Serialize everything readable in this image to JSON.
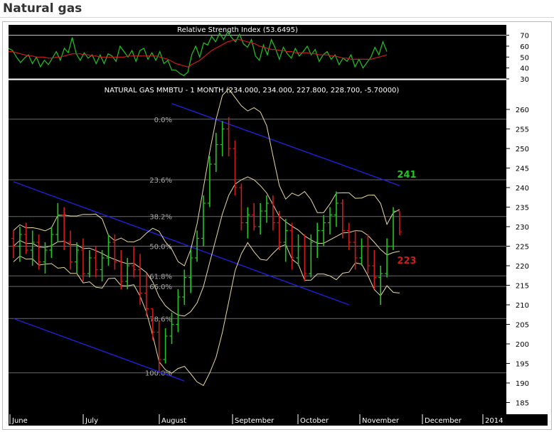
{
  "page": {
    "title": "Natural gas"
  },
  "chart_data": [
    {
      "type": "line",
      "title": "Relative Strength Index (53.6495)",
      "ylim": [
        30,
        73
      ],
      "yticks": [
        "70",
        "60",
        "50",
        "40",
        "30"
      ],
      "series": [
        {
          "color": "#22c422",
          "values": [
            58,
            56,
            50,
            45,
            49,
            52,
            44,
            50,
            41,
            47,
            43,
            49,
            55,
            47,
            58,
            54,
            68,
            53,
            47,
            54,
            49,
            52,
            44,
            52,
            44,
            53,
            51,
            46,
            60,
            55,
            50,
            56,
            46,
            56,
            58,
            48,
            54,
            47,
            55,
            44,
            47,
            38,
            38,
            35,
            33,
            36,
            52,
            60,
            50,
            63,
            61,
            69,
            64,
            72,
            66,
            73,
            68,
            64,
            71,
            62,
            59,
            66,
            51,
            47,
            61,
            52,
            66,
            58,
            48,
            59,
            53,
            49,
            58,
            51,
            55,
            60,
            52,
            57,
            46,
            52,
            55,
            48,
            52,
            43,
            49,
            46,
            52,
            41,
            48,
            40,
            45,
            50,
            59,
            52,
            64,
            55
          ]
        },
        {
          "color": "#d11a1a",
          "values": [
            55,
            55,
            54,
            53,
            52,
            51,
            51,
            50,
            50,
            50,
            49,
            49,
            50,
            50,
            51,
            52,
            53,
            53,
            53,
            52,
            52,
            51,
            51,
            50,
            50,
            50,
            50,
            50,
            50,
            50,
            51,
            51,
            51,
            51,
            51,
            51,
            51,
            51,
            50,
            49,
            48,
            46,
            44,
            43,
            42,
            41,
            43,
            45,
            47,
            50,
            53,
            56,
            58,
            60,
            62,
            64,
            65,
            66,
            66,
            65,
            64,
            63,
            62,
            60,
            59,
            58,
            57,
            57,
            56,
            56,
            55,
            55,
            54,
            54,
            54,
            54,
            53,
            53,
            52,
            52,
            52,
            51,
            51,
            50,
            49,
            49,
            48,
            48,
            48,
            48,
            48,
            48,
            49,
            50,
            51,
            52
          ]
        }
      ]
    },
    {
      "type": "bar",
      "subtype": "ohlc",
      "title": "NATURAL GAS MMBTU - 1 MONTH (234.000, 234.000, 227.800, 228.700, -5.70000)",
      "ylim": [
        182,
        262
      ],
      "yticks": [
        "260",
        "255",
        "250",
        "245",
        "240",
        "235",
        "230",
        "225",
        "220",
        "215",
        "210",
        "205",
        "200",
        "195",
        "190",
        "185"
      ],
      "xticks": [
        "June",
        "July",
        "August",
        "September",
        "October",
        "November",
        "December",
        "2014"
      ],
      "fib_levels": [
        {
          "label": "0.0%",
          "value": 257.5
        },
        {
          "label": "23.6%",
          "value": 242.0
        },
        {
          "label": "38.2%",
          "value": 232.6
        },
        {
          "label": "50.0%",
          "value": 225.0
        },
        {
          "label": "61.8%",
          "value": 217.4
        },
        {
          "label": "66.0%",
          "value": 214.7
        },
        {
          "label": "78.6%",
          "value": 206.5
        },
        {
          "label": "100.0%",
          "value": 192.6
        }
      ],
      "annotations": [
        {
          "text": "241",
          "color": "#22c422",
          "value": 243.5
        },
        {
          "text": "223",
          "color": "#d11a1a",
          "value": 221.5
        }
      ],
      "channels": [
        {
          "from": [
            0,
            241.5
          ],
          "to": [
            53,
            210.0
          ]
        },
        {
          "from": [
            0,
            206.5
          ],
          "to": [
            27,
            190.5
          ]
        },
        {
          "from": [
            25,
            261.5
          ],
          "to": [
            61,
            240.5
          ]
        }
      ],
      "candles": [
        {
          "o": 227,
          "h": 229,
          "l": 222,
          "c": 225
        },
        {
          "o": 225,
          "h": 230,
          "l": 221,
          "c": 228
        },
        {
          "o": 228,
          "h": 231,
          "l": 223,
          "c": 224
        },
        {
          "o": 224,
          "h": 229,
          "l": 220,
          "c": 226
        },
        {
          "o": 226,
          "h": 228,
          "l": 219,
          "c": 221
        },
        {
          "o": 221,
          "h": 226,
          "l": 218,
          "c": 224
        },
        {
          "o": 224,
          "h": 230,
          "l": 222,
          "c": 228
        },
        {
          "o": 228,
          "h": 236,
          "l": 226,
          "c": 233
        },
        {
          "o": 233,
          "h": 235,
          "l": 224,
          "c": 226
        },
        {
          "o": 226,
          "h": 229,
          "l": 219,
          "c": 221
        },
        {
          "o": 221,
          "h": 226,
          "l": 218,
          "c": 224
        },
        {
          "o": 224,
          "h": 227,
          "l": 216,
          "c": 218
        },
        {
          "o": 218,
          "h": 224,
          "l": 217,
          "c": 222
        },
        {
          "o": 222,
          "h": 225,
          "l": 217,
          "c": 219
        },
        {
          "o": 219,
          "h": 224,
          "l": 216,
          "c": 222
        },
        {
          "o": 222,
          "h": 228,
          "l": 220,
          "c": 226
        },
        {
          "o": 226,
          "h": 228,
          "l": 219,
          "c": 221
        },
        {
          "o": 221,
          "h": 224,
          "l": 214,
          "c": 216
        },
        {
          "o": 216,
          "h": 222,
          "l": 214,
          "c": 220
        },
        {
          "o": 220,
          "h": 225,
          "l": 217,
          "c": 219
        },
        {
          "o": 219,
          "h": 223,
          "l": 210,
          "c": 213
        },
        {
          "o": 213,
          "h": 218,
          "l": 207,
          "c": 209
        },
        {
          "o": 209,
          "h": 207,
          "l": 201,
          "c": 203
        },
        {
          "o": 203,
          "h": 206,
          "l": 193,
          "c": 196
        },
        {
          "o": 196,
          "h": 204,
          "l": 195,
          "c": 202
        },
        {
          "o": 202,
          "h": 208,
          "l": 200,
          "c": 205
        },
        {
          "o": 205,
          "h": 214,
          "l": 203,
          "c": 212
        },
        {
          "o": 212,
          "h": 219,
          "l": 210,
          "c": 217
        },
        {
          "o": 217,
          "h": 224,
          "l": 213,
          "c": 222
        },
        {
          "o": 222,
          "h": 229,
          "l": 221,
          "c": 227
        },
        {
          "o": 227,
          "h": 238,
          "l": 225,
          "c": 236
        },
        {
          "o": 236,
          "h": 248,
          "l": 235,
          "c": 246
        },
        {
          "o": 246,
          "h": 254,
          "l": 244,
          "c": 251
        },
        {
          "o": 251,
          "h": 257,
          "l": 248,
          "c": 255
        },
        {
          "o": 255,
          "h": 258,
          "l": 248,
          "c": 250
        },
        {
          "o": 250,
          "h": 252,
          "l": 238,
          "c": 240
        },
        {
          "o": 240,
          "h": 241,
          "l": 229,
          "c": 231
        },
        {
          "o": 231,
          "h": 235,
          "l": 227,
          "c": 233
        },
        {
          "o": 233,
          "h": 236,
          "l": 229,
          "c": 230
        },
        {
          "o": 230,
          "h": 236,
          "l": 228,
          "c": 234
        },
        {
          "o": 234,
          "h": 238,
          "l": 231,
          "c": 236
        },
        {
          "o": 236,
          "h": 238,
          "l": 229,
          "c": 231
        },
        {
          "o": 231,
          "h": 234,
          "l": 224,
          "c": 226
        },
        {
          "o": 226,
          "h": 232,
          "l": 221,
          "c": 229
        },
        {
          "o": 229,
          "h": 231,
          "l": 219,
          "c": 222
        },
        {
          "o": 222,
          "h": 228,
          "l": 220,
          "c": 225
        },
        {
          "o": 225,
          "h": 228,
          "l": 216,
          "c": 218
        },
        {
          "o": 218,
          "h": 228,
          "l": 217,
          "c": 226
        },
        {
          "o": 226,
          "h": 231,
          "l": 222,
          "c": 229
        },
        {
          "o": 229,
          "h": 233,
          "l": 225,
          "c": 231
        },
        {
          "o": 231,
          "h": 235,
          "l": 228,
          "c": 233
        },
        {
          "o": 233,
          "h": 239,
          "l": 230,
          "c": 236
        },
        {
          "o": 236,
          "h": 237,
          "l": 227,
          "c": 229
        },
        {
          "o": 229,
          "h": 231,
          "l": 224,
          "c": 226
        },
        {
          "o": 226,
          "h": 229,
          "l": 219,
          "c": 222
        },
        {
          "o": 222,
          "h": 227,
          "l": 220,
          "c": 225
        },
        {
          "o": 225,
          "h": 228,
          "l": 218,
          "c": 220
        },
        {
          "o": 220,
          "h": 224,
          "l": 214,
          "c": 217
        },
        {
          "o": 217,
          "h": 220,
          "l": 210,
          "c": 218
        },
        {
          "o": 218,
          "h": 227,
          "l": 217,
          "c": 225
        },
        {
          "o": 225,
          "h": 235,
          "l": 224,
          "c": 234
        },
        {
          "o": 234,
          "h": 234,
          "l": 227.8,
          "c": 228.7
        }
      ]
    }
  ]
}
